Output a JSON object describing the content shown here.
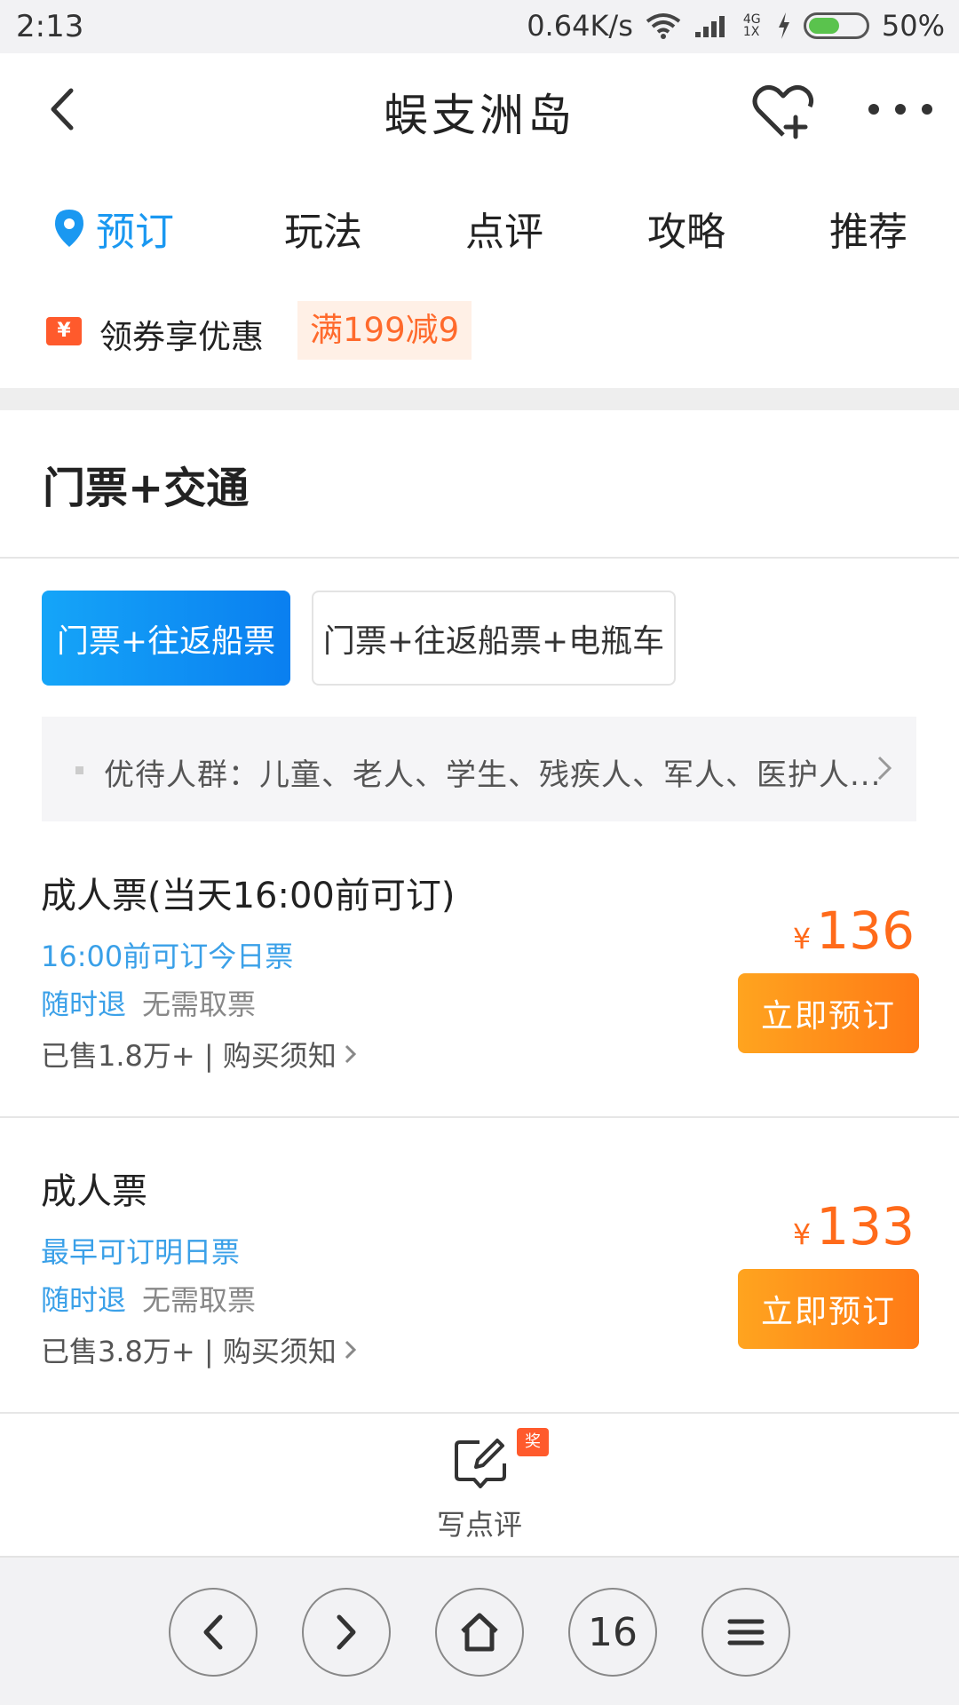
{
  "status_bar": {
    "time": "2:13",
    "net_speed": "0.64K/s",
    "network_type": "4G 1X",
    "battery": "50%",
    "battery_level": 0.5
  },
  "header": {
    "title": "蜈支洲岛",
    "icons": [
      "back-icon",
      "favorite-add-icon",
      "more-icon"
    ]
  },
  "tabs": [
    {
      "label": "预订",
      "active": true
    },
    {
      "label": "玩法",
      "active": false
    },
    {
      "label": "点评",
      "active": false
    },
    {
      "label": "攻略",
      "active": false
    },
    {
      "label": "推荐",
      "active": false
    }
  ],
  "coupon": {
    "icon_text": "¥",
    "label": "领券享优惠",
    "tag": "满199减9"
  },
  "section": {
    "title": "门票+交通"
  },
  "package_tabs": [
    {
      "label": "门票+往返船票",
      "active": true
    },
    {
      "label": "门票+往返船票+电瓶车",
      "active": false
    }
  ],
  "discount": {
    "text": "优待人群：儿童、老人、学生、残疾人、军人、医护人..."
  },
  "tickets": [
    {
      "name": "成人票(当天16:00前可订)",
      "note": "16:00前可订今日票",
      "refund": "随时退",
      "pickup": "无需取票",
      "sold": "已售1.8万+ | 购买须知",
      "currency": "¥",
      "price": "136",
      "book_label": "立即预订"
    },
    {
      "name": "成人票",
      "note": "最早可订明日票",
      "refund": "随时退",
      "pickup": "无需取票",
      "sold": "已售3.8万+ | 购买须知",
      "currency": "¥",
      "price": "133",
      "book_label": "立即预订"
    }
  ],
  "review": {
    "label": "写点评",
    "badge": "奖"
  },
  "bottom_nav": {
    "tab_count": "16",
    "icons": [
      "back-icon",
      "forward-icon",
      "home-icon",
      "tabs-icon",
      "menu-icon"
    ]
  },
  "colors": {
    "accent_blue": "#1a98f1",
    "price_orange": "#ff6a1a",
    "book_button": "#ff8c1a"
  }
}
